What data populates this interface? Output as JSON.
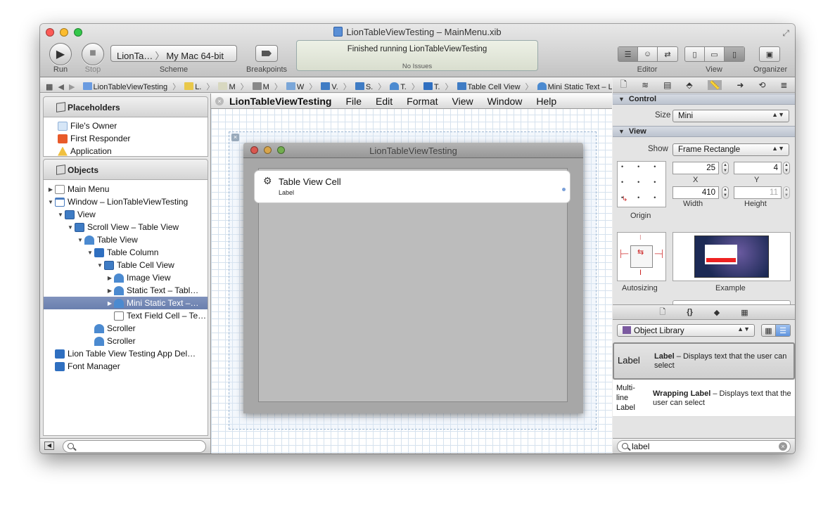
{
  "window": {
    "title": "LionTableViewTesting – MainMenu.xib",
    "colors": {
      "close": "#fc5b57",
      "minimize": "#fcbc2e",
      "zoom": "#34c84a"
    }
  },
  "toolbar": {
    "run_label": "Run",
    "stop_label": "Stop",
    "scheme_label": "Scheme",
    "scheme_target": "LionTa…",
    "scheme_destination": "My Mac 64-bit",
    "breakpoints_label": "Breakpoints",
    "activity_status": "Finished running LionTableViewTesting",
    "activity_issues": "No Issues",
    "editor_label": "Editor",
    "view_label": "View",
    "organizer_label": "Organizer"
  },
  "jumpbar": {
    "items": [
      "LionTableViewTesting",
      "L.",
      "M",
      "M",
      "W",
      "V.",
      "S.",
      "T.",
      "T.",
      "Table Cell View",
      "Mini Static Text – Label"
    ]
  },
  "outline": {
    "placeholders_header": "Placeholders",
    "placeholders": [
      "File's Owner",
      "First Responder",
      "Application"
    ],
    "objects_header": "Objects",
    "objects": [
      {
        "label": "Main Menu",
        "disclosure": "collapsed"
      },
      {
        "label": "Window – LionTableViewTesting",
        "disclosure": "expanded"
      },
      {
        "label": "View",
        "disclosure": "expanded"
      },
      {
        "label": "Scroll View – Table View",
        "disclosure": "expanded"
      },
      {
        "label": "Table View",
        "disclosure": "expanded"
      },
      {
        "label": "Table Column",
        "disclosure": "expanded"
      },
      {
        "label": "Table Cell View",
        "disclosure": "expanded"
      },
      {
        "label": "Image View",
        "disclosure": "collapsed"
      },
      {
        "label": "Static Text – Tabl…",
        "disclosure": "collapsed"
      },
      {
        "label": "Mini Static Text –…",
        "disclosure": "collapsed",
        "selected": true
      },
      {
        "label": "Text Field Cell – Te…",
        "disclosure": "none"
      },
      {
        "label": "Scroller",
        "disclosure": "none"
      },
      {
        "label": "Scroller",
        "disclosure": "none"
      },
      {
        "label": "Lion Table View Testing App Del…",
        "disclosure": "none"
      },
      {
        "label": "Font Manager",
        "disclosure": "none"
      }
    ]
  },
  "canvas": {
    "menu_app": "LionTableViewTesting",
    "menu_items": [
      "File",
      "Edit",
      "Format",
      "View",
      "Window",
      "Help"
    ],
    "inner_window_title": "LionTableViewTesting",
    "cell_title": "Table View Cell",
    "cell_subtitle": "Label"
  },
  "inspector": {
    "control_section": "Control",
    "size_label": "Size",
    "size_value": "Mini",
    "view_section": "View",
    "show_label": "Show",
    "show_value": "Frame Rectangle",
    "x_value": "25",
    "y_value": "4",
    "width_value": "410",
    "height_value": "11",
    "x_label": "X",
    "y_label": "Y",
    "width_label": "Width",
    "height_label": "Height",
    "origin_label": "Origin",
    "autosizing_label": "Autosizing",
    "example_label": "Example"
  },
  "library": {
    "selector": "Object Library",
    "items": [
      {
        "name": "Label",
        "title": "Label",
        "desc": " – Displays text that the user can select"
      },
      {
        "name": "Multi-line Label",
        "title": "Wrapping Label",
        "desc": " – Displays text that the user can select"
      }
    ],
    "search_value": "label"
  }
}
